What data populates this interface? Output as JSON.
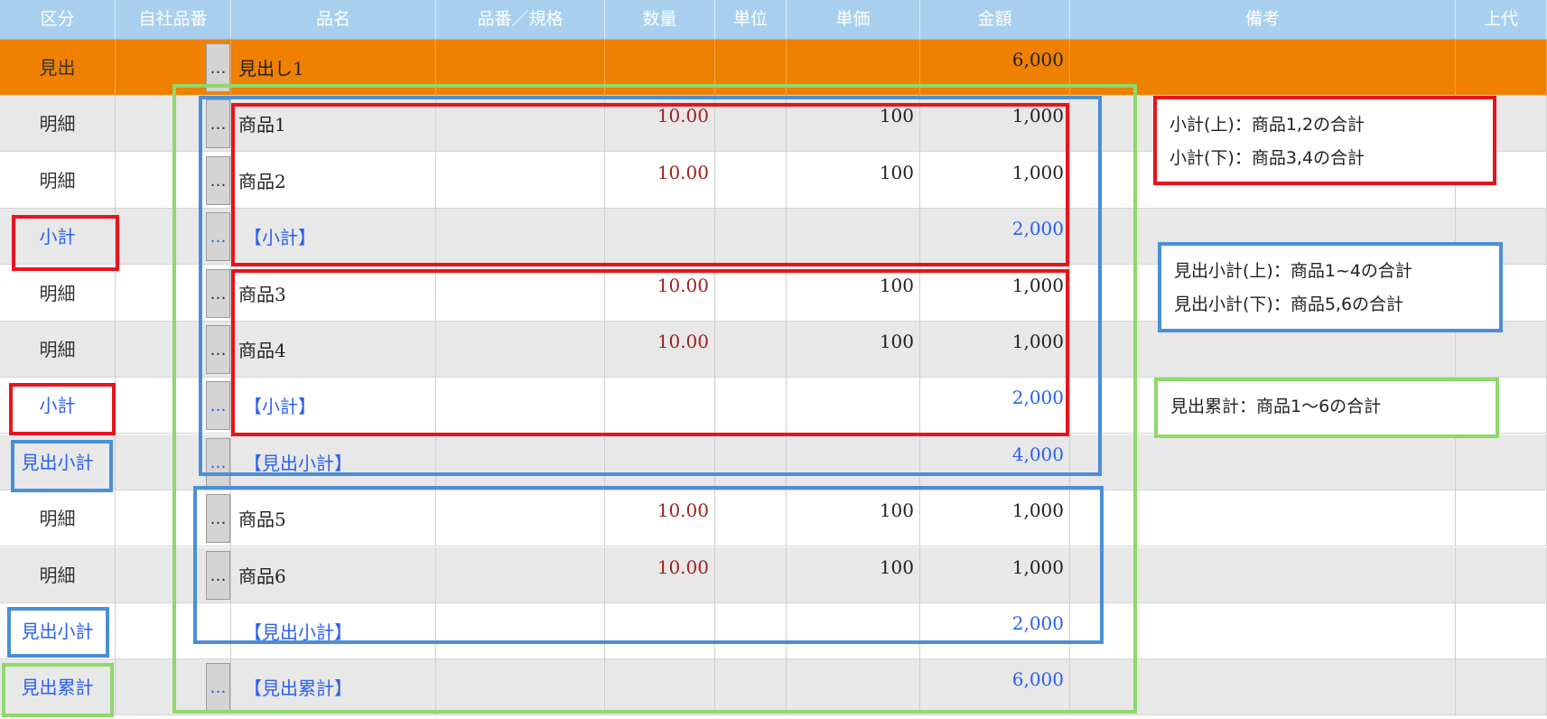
{
  "header": {
    "columns": [
      "区分",
      "自社品番",
      "品名",
      "品番／規格",
      "数量",
      "単位",
      "単価",
      "金額",
      "備考",
      "上代"
    ]
  },
  "rows": [
    {
      "kubun": "見出",
      "name": "見出し1",
      "qty": "",
      "price": "",
      "amount": "6,000"
    },
    {
      "kubun": "明細",
      "name": "商品1",
      "qty": "10.00",
      "price": "100",
      "amount": "1,000"
    },
    {
      "kubun": "明細",
      "name": "商品2",
      "qty": "10.00",
      "price": "100",
      "amount": "1,000"
    },
    {
      "kubun": "小計",
      "name": "【小計】",
      "qty": "",
      "price": "",
      "amount": "2,000"
    },
    {
      "kubun": "明細",
      "name": "商品3",
      "qty": "10.00",
      "price": "100",
      "amount": "1,000"
    },
    {
      "kubun": "明細",
      "name": "商品4",
      "qty": "10.00",
      "price": "100",
      "amount": "1,000"
    },
    {
      "kubun": "小計",
      "name": "【小計】",
      "qty": "",
      "price": "",
      "amount": "2,000"
    },
    {
      "kubun": "見出小計",
      "name": "【見出小計】",
      "qty": "",
      "price": "",
      "amount": "4,000"
    },
    {
      "kubun": "明細",
      "name": "商品5",
      "qty": "10.00",
      "price": "100",
      "amount": "1,000"
    },
    {
      "kubun": "明細",
      "name": "商品6",
      "qty": "10.00",
      "price": "100",
      "amount": "1,000"
    },
    {
      "kubun": "見出小計",
      "name": "【見出小計】",
      "qty": "",
      "price": "",
      "amount": "2,000"
    },
    {
      "kubun": "見出累計",
      "name": "【見出累計】",
      "qty": "",
      "price": "",
      "amount": "6,000"
    }
  ],
  "button_glyph": "…",
  "notes": {
    "red": [
      "小計(上)：商品1,2の合計",
      "小計(下)：商品3,4の合計"
    ],
    "blue": [
      "見出小計(上)：商品1~4の合計",
      "見出小計(下)：商品5,6の合計"
    ],
    "green": [
      "見出累計：商品1～6の合計"
    ]
  },
  "colors": {
    "red": "#e8141c",
    "blue": "#4a8fd6",
    "green": "#8fd86a",
    "orange": "#f08000",
    "header": "#a8d0ee",
    "link_blue": "#2b5ff0"
  }
}
